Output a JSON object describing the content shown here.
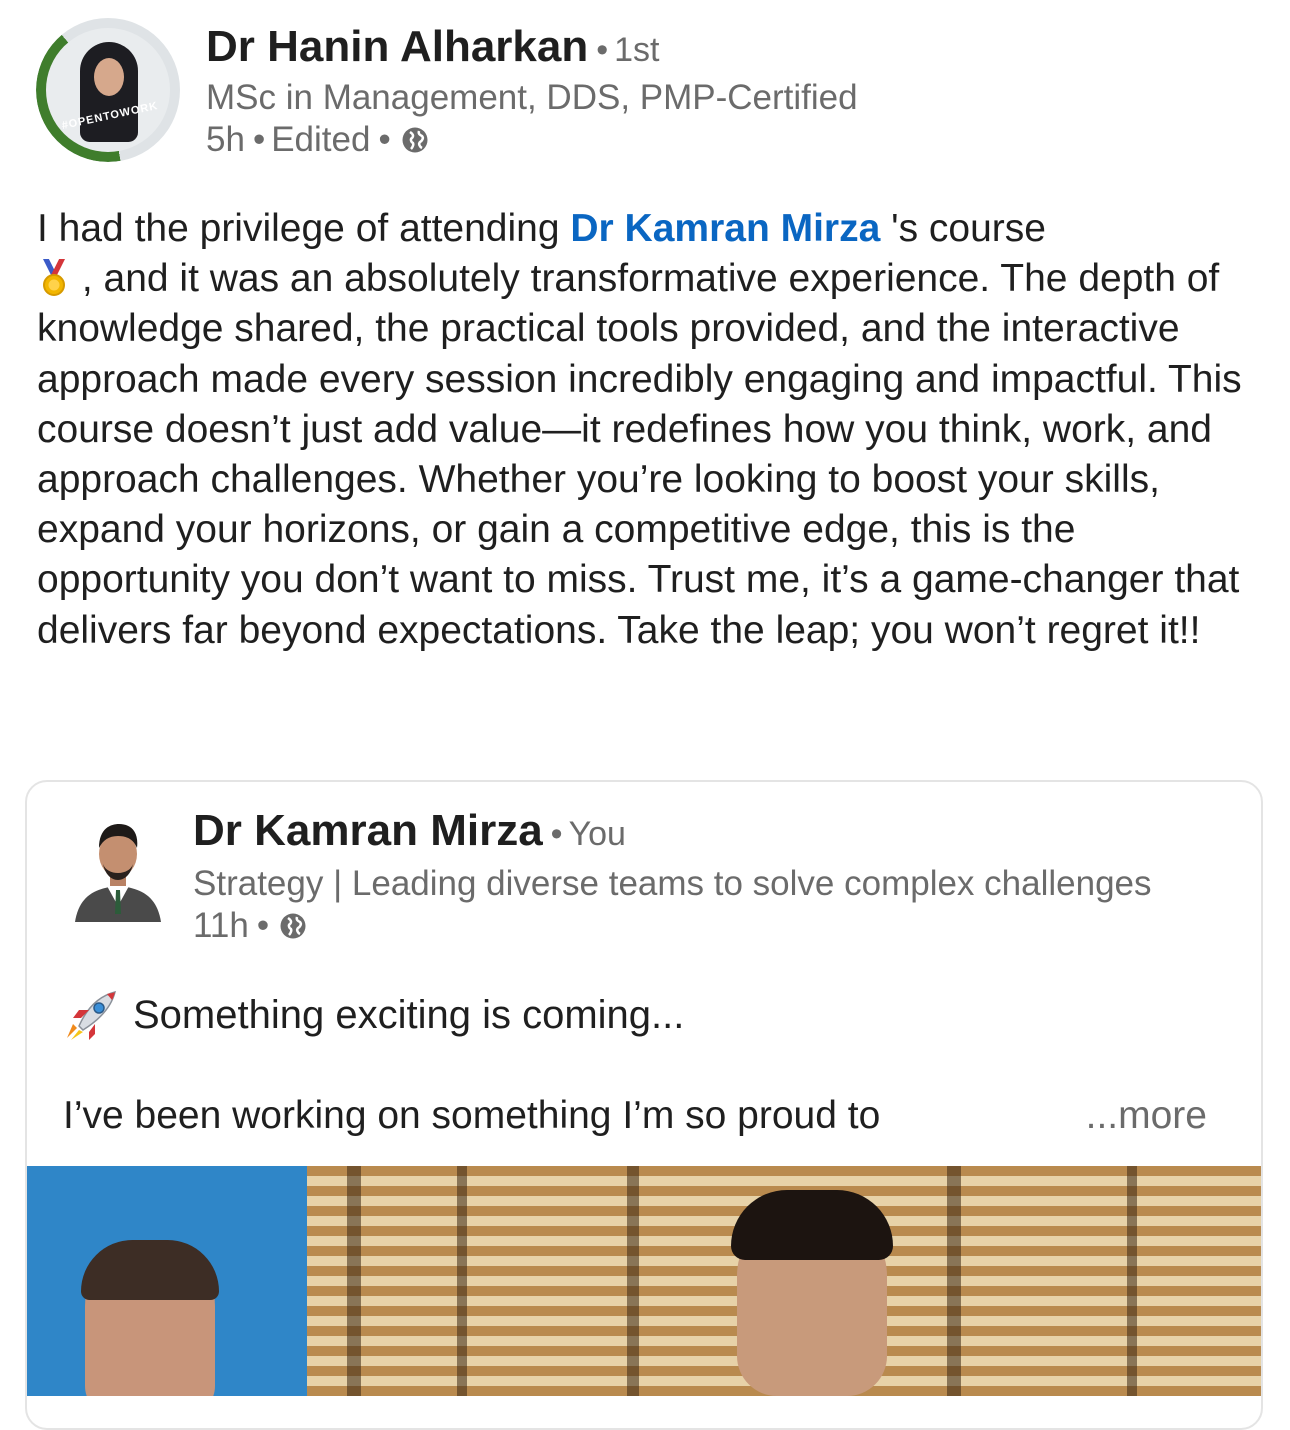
{
  "post": {
    "author": {
      "name": "Dr Hanin Alharkan",
      "connection": "1st",
      "headline": "MSc in Management, DDS, PMP-Certified",
      "time": "5h",
      "edited": "Edited",
      "badge": "#OPENTOWORK",
      "visibility_icon": "globe-icon"
    },
    "body": {
      "text_before_mention": "I had the privilege of attending ",
      "mention": "Dr Kamran Mirza",
      "text_after_mention": " 's   course",
      "emoji": "medal-icon",
      "text_after_emoji": " , and it was an absolutely transformative experience. The depth of knowledge shared, the practical tools provided, and the interactive approach made every session incredibly engaging and impactful. This course doesn’t just add value—it redefines how you think, work, and approach challenges. Whether you’re looking to boost your skills, expand your horizons, or gain a competitive edge, this is the opportunity you don’t want to miss. Trust me, it’s a game-changer that delivers far beyond expectations. Take the leap; you won’t regret it!!"
    }
  },
  "shared": {
    "author": {
      "name": "Dr Kamran Mirza",
      "connection": "You",
      "headline": "Strategy | Leading diverse teams to solve complex challenges",
      "time": "11h",
      "visibility_icon": "globe-icon"
    },
    "line1_icon": "rocket-icon",
    "line1": "Something exciting is coming...",
    "line2": "I’ve been working on something I’m so proud to",
    "more": "...more"
  },
  "colors": {
    "mention": "#0a66c2",
    "secondary_text": "#6b6b6b",
    "primary_text": "#1f1f1f",
    "open_to_work_ring": "#3f7d2c"
  }
}
